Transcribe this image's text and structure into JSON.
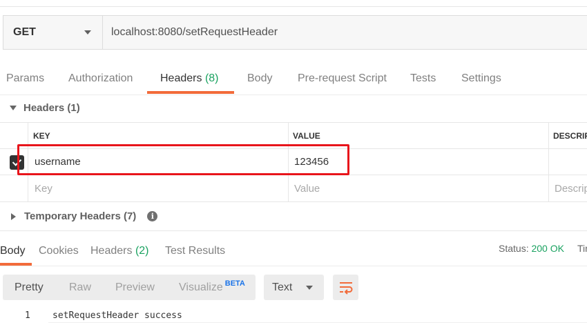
{
  "request": {
    "method": "GET",
    "url": "localhost:8080/setRequestHeader"
  },
  "request_tabs": {
    "params": "Params",
    "authorization": "Authorization",
    "headers": "Headers",
    "headers_count": "(8)",
    "body": "Body",
    "prerequest": "Pre-request Script",
    "tests": "Tests",
    "settings": "Settings"
  },
  "headers_section": {
    "title": "Headers",
    "count": "(1)",
    "columns": {
      "key": "KEY",
      "value": "VALUE",
      "description": "DESCRIP"
    },
    "rows": [
      {
        "checked": true,
        "key": "username",
        "value": "123456",
        "description": ""
      }
    ],
    "placeholder": {
      "key": "Key",
      "value": "Value",
      "description": "Descrip"
    }
  },
  "temporary_headers": {
    "title": "Temporary Headers",
    "count": "(7)",
    "info_icon": "info-icon"
  },
  "response_tabs": {
    "body": "Body",
    "cookies": "Cookies",
    "headers": "Headers",
    "headers_count": "(2)",
    "test_results": "Test Results"
  },
  "status": {
    "label": "Status:",
    "value": "200 OK",
    "time_label": "Tir"
  },
  "response_toolbar": {
    "pretty": "Pretty",
    "raw": "Raw",
    "preview": "Preview",
    "visualize": "Visualize",
    "beta": "BETA",
    "format": "Text",
    "wrap_icon": "wrap-lines-icon"
  },
  "response_body": {
    "lines": [
      {
        "number": "1",
        "text": "setRequestHeader success"
      }
    ]
  },
  "colors": {
    "accent": "#f26b3a",
    "success": "#1aa260",
    "highlight_box": "#e8141b"
  }
}
